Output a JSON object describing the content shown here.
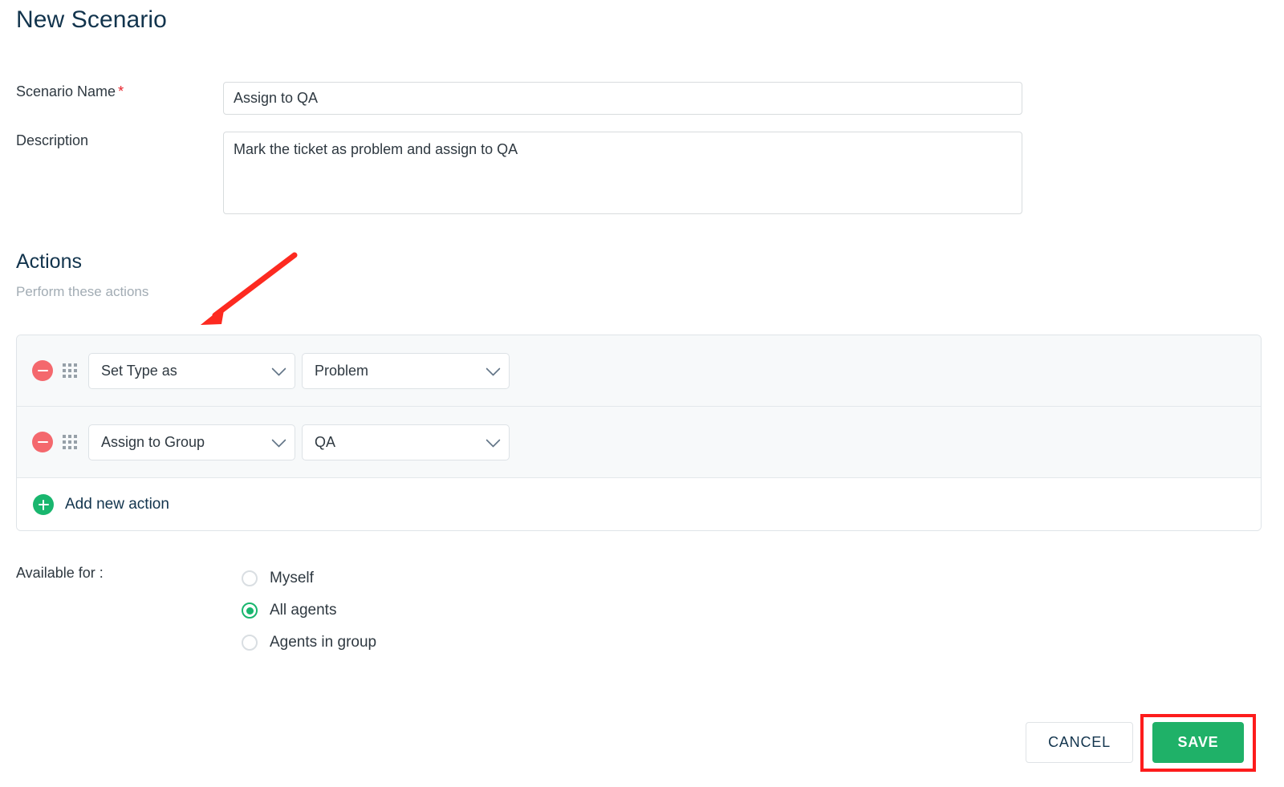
{
  "page": {
    "title": "New Scenario"
  },
  "form": {
    "scenario_name": {
      "label": "Scenario Name",
      "required_marker": "*",
      "value": "Assign to QA",
      "placeholder": ""
    },
    "description": {
      "label": "Description",
      "value": "Mark the ticket as problem and assign to QA",
      "placeholder": ""
    }
  },
  "actions_section": {
    "title": "Actions",
    "subtitle": "Perform these actions",
    "rows": [
      {
        "remove_icon": "minus-circle-icon",
        "drag_icon": "drag-handle-icon",
        "action_select": "Set Type as",
        "value_select": "Problem"
      },
      {
        "remove_icon": "minus-circle-icon",
        "drag_icon": "drag-handle-icon",
        "action_select": "Assign to Group",
        "value_select": "QA"
      }
    ],
    "add_action": {
      "icon": "plus-circle-icon",
      "label": "Add new action"
    }
  },
  "available_for": {
    "label": "Available for :",
    "options": [
      {
        "label": "Myself",
        "selected": false
      },
      {
        "label": "All agents",
        "selected": true
      },
      {
        "label": "Agents in group",
        "selected": false
      }
    ]
  },
  "footer": {
    "cancel_label": "CANCEL",
    "save_label": "SAVE"
  },
  "annotations": {
    "arrow": {
      "name": "red-arrow-annotation",
      "color": "#fd2a20"
    },
    "highlight_box": {
      "name": "red-highlight-box-annotation",
      "color": "#fd1c1c",
      "target": "SAVE"
    }
  },
  "colors": {
    "heading": "#12344d",
    "accent_green": "#1fb168",
    "danger_red": "#f4686d",
    "annotation_red": "#fd1c1c",
    "border": "#dfe4e8",
    "row_bg": "#f7f9fa"
  }
}
